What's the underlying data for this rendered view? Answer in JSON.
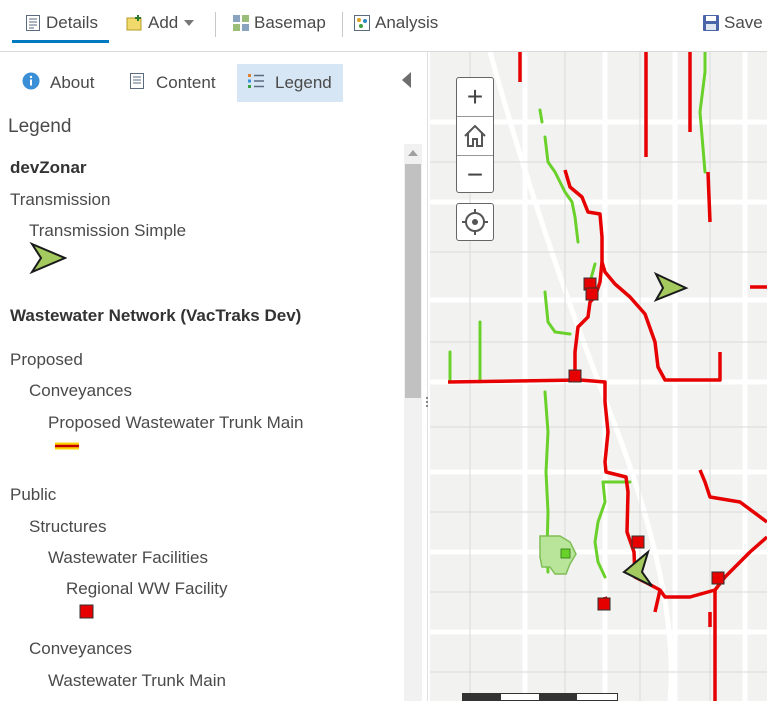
{
  "toolbar": {
    "details_label": "Details",
    "add_label": "Add",
    "basemap_label": "Basemap",
    "analysis_label": "Analysis",
    "save_label": "Save",
    "active_tab": "Details"
  },
  "panel_tabs": {
    "about_label": "About",
    "content_label": "Content",
    "legend_label": "Legend",
    "active": "Legend"
  },
  "legend": {
    "heading": "Legend",
    "map_title": "devZonar",
    "transmission_group": "Transmission",
    "transmission_layer": "Transmission Simple",
    "network_title": "Wastewater Network (VacTraks Dev)",
    "proposed_group": "Proposed",
    "proposed_conveyances": "Conveyances",
    "proposed_trunk_main": "Proposed Wastewater Trunk Main",
    "public_group": "Public",
    "structures": "Structures",
    "wastewater_facilities": "Wastewater Facilities",
    "regional_ww_facility": "Regional WW Facility",
    "public_conveyances": "Conveyances",
    "wastewater_trunk_main": "Wastewater Trunk Main"
  },
  "map": {
    "zoom_in_symbol": "+",
    "zoom_out_symbol": "−",
    "home_icon": "home-icon",
    "locate_icon": "locate-icon"
  },
  "colors": {
    "accent": "#0079c1",
    "active_tab_bg": "#d7e6f4",
    "trunk_main_red": "#e60000",
    "green_line": "#6ad12a",
    "arrow_green": "#a3c95f"
  }
}
